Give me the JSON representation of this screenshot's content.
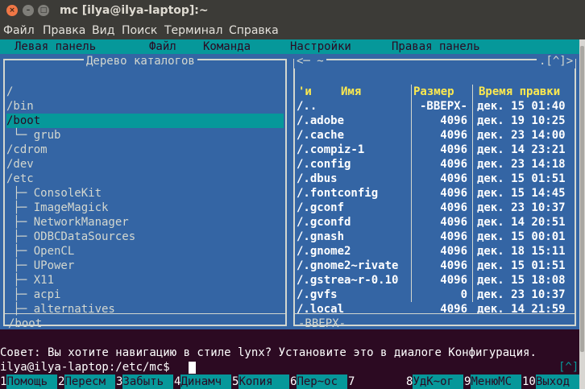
{
  "window": {
    "title": "mc [ilya@ilya-laptop]:~",
    "close_glyph": "×",
    "minimize_glyph": "–",
    "maximize_glyph": "□"
  },
  "menubar": [
    "Файл",
    "Правка",
    "Вид",
    "Поиск",
    "Терминал",
    "Справка"
  ],
  "mc_menu": [
    "Левая панель",
    "Файл",
    "Команда",
    "Настройки",
    "Правая панель"
  ],
  "left_panel": {
    "title": "Дерево каталогов",
    "items": [
      {
        "text": "/",
        "selected": false
      },
      {
        "text": "/bin",
        "selected": false
      },
      {
        "text": "/boot",
        "selected": true
      },
      {
        "text": " └─ grub",
        "selected": false
      },
      {
        "text": "/cdrom",
        "selected": false
      },
      {
        "text": "/dev",
        "selected": false
      },
      {
        "text": "/etc",
        "selected": false
      },
      {
        "text": " ├─ ConsoleKit",
        "selected": false
      },
      {
        "text": " ├─ ImageMagick",
        "selected": false
      },
      {
        "text": " ├─ NetworkManager",
        "selected": false
      },
      {
        "text": " ├─ ODBCDataSources",
        "selected": false
      },
      {
        "text": " ├─ OpenCL",
        "selected": false
      },
      {
        "text": " ├─ UPower",
        "selected": false
      },
      {
        "text": " ├─ X11",
        "selected": false
      },
      {
        "text": " ├─ acpi",
        "selected": false
      },
      {
        "text": " ├─ alternatives",
        "selected": false
      }
    ],
    "status": "/boot"
  },
  "right_panel": {
    "path": "<─ ~",
    "path_right": ".[^]>",
    "columns": {
      "sort": "'и",
      "name": "Имя",
      "size": "Размер",
      "time": "Время правки"
    },
    "files": [
      {
        "name": "/..",
        "size": "-ВВЕРХ-",
        "time": "дек. 15 01:40"
      },
      {
        "name": "/.adobe",
        "size": "4096",
        "time": "дек. 19 10:25"
      },
      {
        "name": "/.cache",
        "size": "4096",
        "time": "дек. 23 14:00"
      },
      {
        "name": "/.compiz-1",
        "size": "4096",
        "time": "дек. 14 23:21"
      },
      {
        "name": "/.config",
        "size": "4096",
        "time": "дек. 23 14:18"
      },
      {
        "name": "/.dbus",
        "size": "4096",
        "time": "дек. 15 01:51"
      },
      {
        "name": "/.fontconfig",
        "size": "4096",
        "time": "дек. 15 14:45"
      },
      {
        "name": "/.gconf",
        "size": "4096",
        "time": "дек. 23 10:37"
      },
      {
        "name": "/.gconfd",
        "size": "4096",
        "time": "дек. 14 20:51"
      },
      {
        "name": "/.gnash",
        "size": "4096",
        "time": "дек. 15 00:01"
      },
      {
        "name": "/.gnome2",
        "size": "4096",
        "time": "дек. 18 15:11"
      },
      {
        "name": "/.gnome2~rivate",
        "size": "4096",
        "time": "дек. 15 01:51"
      },
      {
        "name": "/.gstrea~r-0.10",
        "size": "4096",
        "time": "дек. 15 18:08"
      },
      {
        "name": "/.gvfs",
        "size": "0",
        "time": "дек. 23 10:37"
      },
      {
        "name": "/.local",
        "size": "4096",
        "time": "дек. 14 21:59"
      }
    ],
    "status": "-ВВЕРХ-"
  },
  "hint": "Совет: Вы хотите навигацию в стиле lynx? Установите это в диалоге Конфигурация.",
  "prompt": "ilya@ilya-laptop:/etc/mc$",
  "scroll_indicator": "[^]",
  "fkeys": [
    {
      "num": "1",
      "label": "Помощь"
    },
    {
      "num": "2",
      "label": "Пересм"
    },
    {
      "num": "3",
      "label": "Забыть"
    },
    {
      "num": "4",
      "label": "Динамч"
    },
    {
      "num": "5",
      "label": "Копия"
    },
    {
      "num": "6",
      "label": "Пер~ос"
    },
    {
      "num": "7",
      "label": ""
    },
    {
      "num": "8",
      "label": "УдК~ог"
    },
    {
      "num": "9",
      "label": "МенюМС"
    },
    {
      "num": "10",
      "label": "Выход"
    }
  ]
}
